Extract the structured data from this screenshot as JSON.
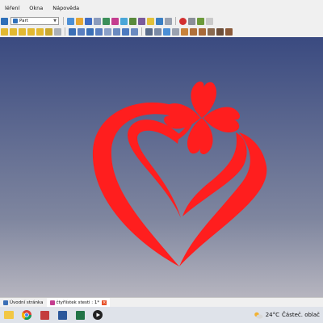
{
  "menubar": {
    "items": [
      "léření",
      "Okna",
      "Nápověda"
    ]
  },
  "toolbar": {
    "workbench": "Part"
  },
  "viewport": {
    "shape_color": "#ff1e1e",
    "bg_top": "#3a4a80",
    "bg_bottom": "#b6b5bf"
  },
  "document_tabs": [
    {
      "label": "Úvodní stránka",
      "icon": "start-page-icon"
    },
    {
      "label": "čtyřlístek stesti : 1*",
      "icon": "freecad-document-icon"
    }
  ],
  "taskbar": {
    "apps": [
      "file-explorer-icon",
      "chrome-icon",
      "freecad-icon",
      "word-icon",
      "excel-icon",
      "media-player-icon"
    ],
    "weather": {
      "temp": "24°C",
      "desc": "Částeč. oblač"
    }
  }
}
